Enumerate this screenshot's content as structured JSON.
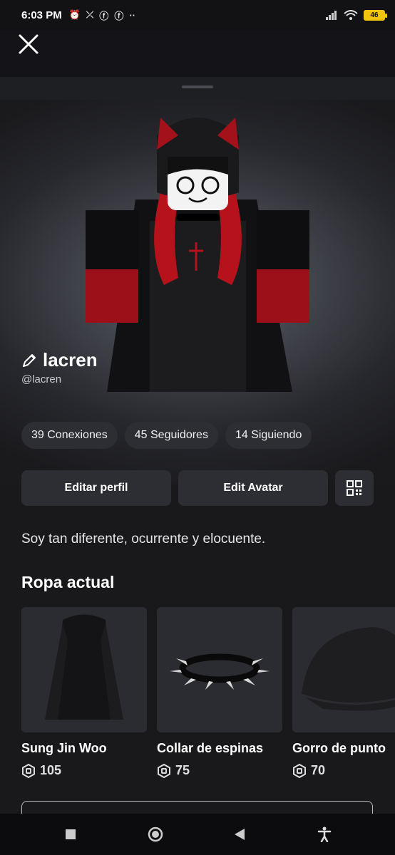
{
  "status_bar": {
    "time": "6:03 PM",
    "battery": "46"
  },
  "profile": {
    "display_name": "lacren",
    "username": "@lacren",
    "stats": {
      "connections": "39 Conexiones",
      "followers": "45 Seguidores",
      "following": "14 Siguiendo"
    },
    "buttons": {
      "edit_profile": "Editar perfil",
      "edit_avatar": "Edit Avatar"
    },
    "bio": "Soy tan diferente, ocurrente y elocuente."
  },
  "current_outfit": {
    "title": "Ropa actual",
    "items": [
      {
        "name": "Sung Jin Woo",
        "price": "105",
        "icon": "robux-icon"
      },
      {
        "name": "Collar de espinas",
        "price": "75",
        "icon": "robux-icon"
      },
      {
        "name": "Gorro de punto",
        "price": "70",
        "icon": "robux-icon"
      }
    ]
  },
  "colors": {
    "accent_red": "#b5121b",
    "battery_yellow": "#f1c40f",
    "pill_bg": "#2d2e33"
  }
}
